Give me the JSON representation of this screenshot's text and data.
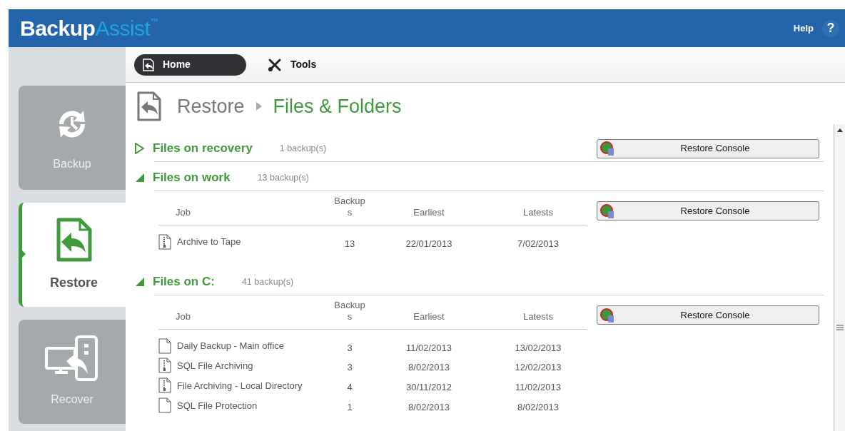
{
  "app": {
    "logo_main": "Backup",
    "logo_accent": "Assist",
    "logo_mark": "™",
    "help": "Help",
    "help_glyph": "?"
  },
  "sidebar": {
    "items": [
      {
        "label": "Backup",
        "kind": "backup",
        "selected": false
      },
      {
        "label": "Restore",
        "kind": "restore",
        "selected": true
      },
      {
        "label": "Recover",
        "kind": "recover",
        "selected": false
      }
    ]
  },
  "toolbar": {
    "tabs": [
      {
        "label": "Home",
        "kind": "home",
        "selected": true
      },
      {
        "label": "Tools",
        "kind": "tools",
        "selected": false
      }
    ]
  },
  "breadcrumb": {
    "parent": "Restore",
    "current": "Files & Folders"
  },
  "sections": [
    {
      "title": "Files on recovery",
      "count": "1 backup(s)",
      "expanded": false,
      "button": "Restore Console"
    },
    {
      "title": "Files on work",
      "count": "13 backup(s)",
      "expanded": true,
      "button": "Restore Console",
      "columns": [
        "Job",
        "Backup\ns",
        "Earliest",
        "Latests"
      ],
      "rows": [
        {
          "kind": "archive",
          "cells": [
            "Archive to Tape",
            "13",
            "22/01/2013",
            "7/02/2013"
          ]
        }
      ]
    },
    {
      "title": "Files on C:",
      "count": "41 backup(s)",
      "expanded": true,
      "button": "Restore Console",
      "columns": [
        "Job",
        "Backup\ns",
        "Earliest",
        "Latests"
      ],
      "rows": [
        {
          "kind": "file",
          "cells": [
            "Daily Backup - Main office",
            "3",
            "11/02/2013",
            "13/02/2013"
          ]
        },
        {
          "kind": "archive",
          "cells": [
            "SQL File Archiving",
            "3",
            "8/02/2013",
            "12/02/2013"
          ]
        },
        {
          "kind": "archive",
          "cells": [
            "File Archiving - Local Directory",
            "4",
            "30/11/2012",
            "11/02/2013"
          ]
        },
        {
          "kind": "file",
          "cells": [
            "SQL File Protection",
            "1",
            "8/02/2013",
            "8/02/2013"
          ]
        }
      ]
    }
  ]
}
